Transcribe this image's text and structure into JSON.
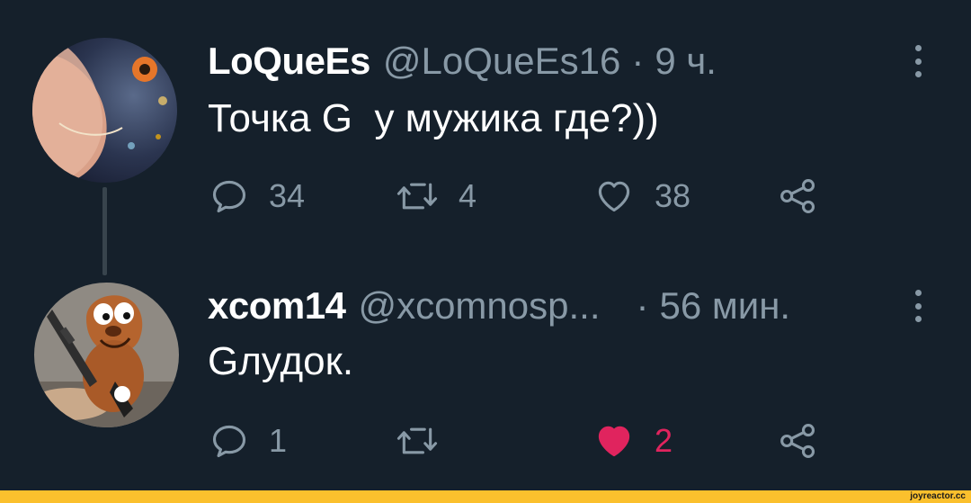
{
  "tweets": [
    {
      "display_name": "LoQueEs",
      "handle": "@LoQueEs16",
      "separator": "·",
      "time": "9 ч.",
      "text": "Точка G  у мужика где?))",
      "counts": {
        "replies": "34",
        "retweets": "4",
        "likes": "38"
      },
      "liked": false
    },
    {
      "display_name": "xcom14",
      "handle": "@xcomnosp...",
      "separator": "·",
      "time": "56 мин.",
      "text": "Gлудок.",
      "counts": {
        "replies": "1",
        "retweets": "",
        "likes": "2"
      },
      "liked": true
    }
  ],
  "icons": {
    "reply": "speech-bubble-icon",
    "retweet": "retweet-arrows-icon",
    "like": "heart-icon",
    "share": "share-nodes-icon",
    "more": "vertical-ellipsis-icon"
  },
  "colors": {
    "background": "#15202b",
    "text": "#ffffff",
    "muted": "#8899a6",
    "like": "#e0245e",
    "watermark_bar": "#fbc02d"
  },
  "watermark": "joyreactor.cc"
}
